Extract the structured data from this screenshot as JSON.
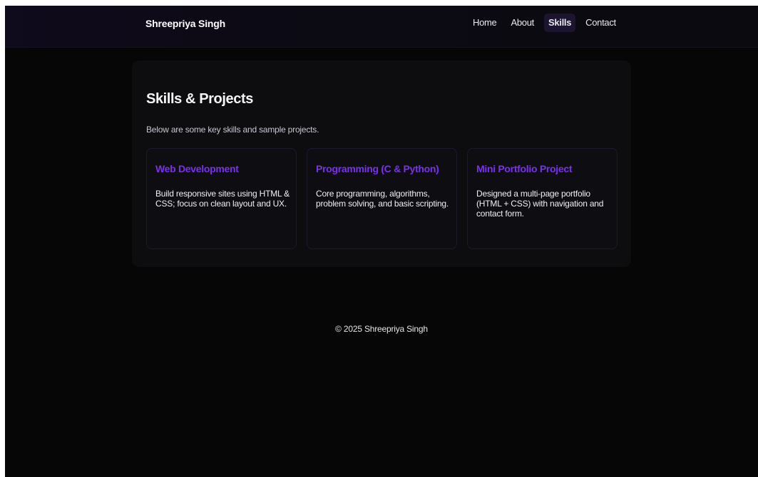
{
  "header": {
    "brand": "Shreepriya Singh",
    "nav": [
      {
        "label": "Home",
        "active": false
      },
      {
        "label": "About",
        "active": false
      },
      {
        "label": "Skills",
        "active": true
      },
      {
        "label": "Contact",
        "active": false
      }
    ]
  },
  "main": {
    "title": "Skills & Projects",
    "subtitle": "Below are some key skills and sample projects.",
    "cards": [
      {
        "title": "Web Development",
        "description": "Build responsive sites using HTML & CSS; focus on clean layout and UX."
      },
      {
        "title": "Programming (C & Python)",
        "description": "Core programming, algorithms, problem solving, and basic scripting."
      },
      {
        "title": "Mini Portfolio Project",
        "description": "Designed a multi-page portfolio (HTML + CSS) with navigation and contact form."
      }
    ]
  },
  "footer": {
    "text": "© 2025 Shreepriya Singh"
  },
  "colors": {
    "accent": "#7b2ff0",
    "background": "#060606",
    "active_nav": "#1d1530"
  }
}
